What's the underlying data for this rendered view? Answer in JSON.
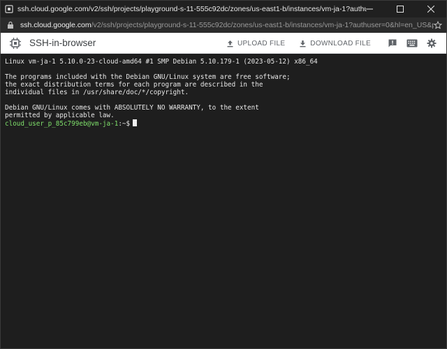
{
  "window": {
    "title": "ssh.cloud.google.com/v2/ssh/projects/playground-s-11-555c92dc/zones/us-east1-b/instances/vm-ja-1?authuser=0&hl=en_US&projectN..."
  },
  "address": {
    "host": "ssh.cloud.google.com",
    "path": "/v2/ssh/projects/playground-s-11-555c92dc/zones/us-east1-b/instances/vm-ja-1?authuser=0&hl=en_US&proj..."
  },
  "app": {
    "title": "SSH-in-browser",
    "upload_label": "UPLOAD FILE",
    "download_label": "DOWNLOAD FILE"
  },
  "terminal": {
    "lines": [
      "Linux vm-ja-1 5.10.0-23-cloud-amd64 #1 SMP Debian 5.10.179-1 (2023-05-12) x86_64",
      "",
      "The programs included with the Debian GNU/Linux system are free software;",
      "the exact distribution terms for each program are described in the",
      "individual files in /usr/share/doc/*/copyright.",
      "",
      "Debian GNU/Linux comes with ABSOLUTELY NO WARRANTY, to the extent",
      "permitted by applicable law."
    ],
    "prompt_user": "cloud_user_p_85c799eb@vm-ja-1",
    "prompt_suffix": ":~$"
  },
  "colors": {
    "terminal_bg": "#1e1e1e",
    "prompt_green": "#7fe06b",
    "titlebar_bg": "#202020"
  },
  "icons": [
    "ssh-chip-icon",
    "upload-icon",
    "download-icon",
    "feedback-icon",
    "keyboard-icon",
    "gear-icon"
  ]
}
